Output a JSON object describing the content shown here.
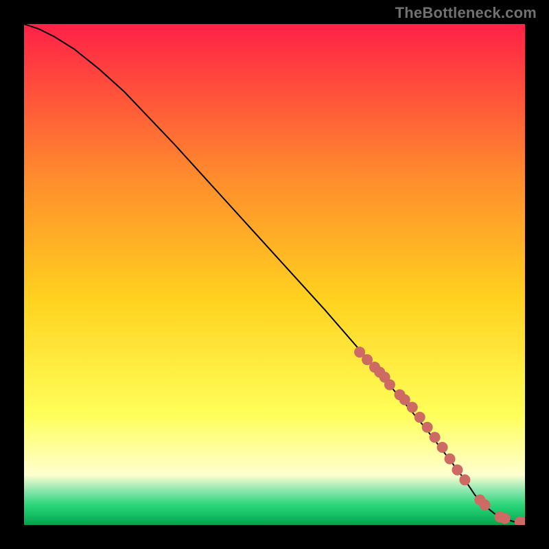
{
  "attribution": "TheBottleneck.com",
  "colors": {
    "gradient_top": "#ff2147",
    "gradient_mid_upper": "#ff8a2d",
    "gradient_mid": "#ffd21f",
    "gradient_mid_lower": "#ffff5a",
    "gradient_pale": "#ffffd0",
    "gradient_green1": "#90e7b0",
    "gradient_green2": "#2bd67a",
    "gradient_green3": "#11b85f",
    "gradient_bottom": "#04a14a",
    "curve": "#000000",
    "marker_fill": "#cc6a63",
    "marker_stroke": "#cc6a63"
  },
  "chart_data": {
    "type": "line",
    "title": "",
    "xlabel": "",
    "ylabel": "",
    "xlim": [
      0,
      100
    ],
    "ylim": [
      0,
      100
    ],
    "curve": {
      "x": [
        0,
        3,
        6,
        10,
        15,
        20,
        30,
        40,
        50,
        60,
        70,
        80,
        85,
        88,
        90,
        92,
        94,
        96,
        98,
        100
      ],
      "y": [
        100,
        99,
        97.5,
        95,
        91,
        86.5,
        76,
        65,
        54,
        43,
        31.5,
        19.5,
        13,
        9,
        6,
        3.8,
        2.2,
        1.2,
        0.6,
        0.5
      ]
    },
    "markers": {
      "x": [
        67,
        68.5,
        70,
        71,
        72,
        73,
        75,
        76,
        77.5,
        79,
        80.5,
        82,
        83.5,
        85,
        86.5,
        88,
        91,
        92,
        95,
        96,
        99,
        100
      ],
      "y": [
        34.5,
        33,
        31.5,
        30.5,
        29.5,
        28,
        26,
        25,
        23.5,
        21.5,
        19.5,
        17.5,
        15.5,
        13.2,
        11,
        9,
        5,
        4,
        1.6,
        1.3,
        0.6,
        0.5
      ]
    }
  }
}
